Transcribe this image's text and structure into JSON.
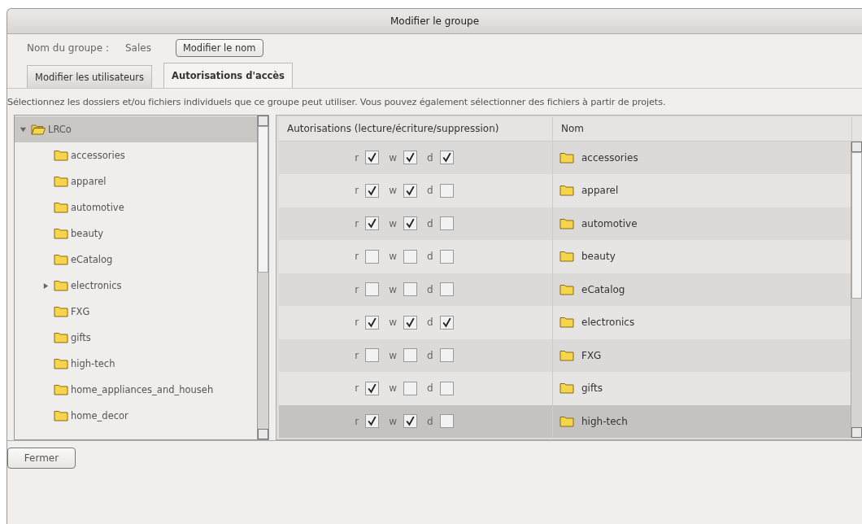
{
  "window": {
    "title": "Modifier le groupe"
  },
  "group": {
    "label": "Nom du groupe :",
    "value": "Sales",
    "rename_button": "Modifier le nom"
  },
  "tabs": [
    {
      "label": "Modifier les utilisateurs",
      "selected": false
    },
    {
      "label": "Autorisations d'accès",
      "selected": true
    }
  ],
  "description": "Sélectionnez les dossiers et/ou fichiers individuels que ce groupe peut utiliser. Vous pouvez également sélectionner des fichiers à partir de projets.",
  "tree": [
    {
      "label": "LRCo",
      "selected": true,
      "expanded": true,
      "children": [
        {
          "label": "accessories",
          "selected": false
        },
        {
          "label": "apparel",
          "selected": false
        },
        {
          "label": "automotive",
          "selected": false
        },
        {
          "label": "beauty",
          "selected": false
        },
        {
          "label": "eCatalog",
          "selected": false
        },
        {
          "label": "electronics",
          "selected": false,
          "expanded": false
        },
        {
          "label": "FXG",
          "selected": false
        },
        {
          "label": "gifts",
          "selected": false
        },
        {
          "label": "high-tech",
          "selected": false
        },
        {
          "label": "home_appliances_and_househ",
          "selected": false
        },
        {
          "label": "home_decor",
          "selected": false
        }
      ]
    }
  ],
  "table": {
    "columns": [
      "Autorisations (lecture/écriture/suppression)",
      "Nom"
    ],
    "rows": [
      {
        "permissions": [
          {
            "letter": "r",
            "checked": true
          },
          {
            "letter": "w",
            "checked": true
          },
          {
            "letter": "d",
            "checked": true
          }
        ],
        "name": "accessories",
        "selected": false
      },
      {
        "permissions": [
          {
            "letter": "r",
            "checked": true
          },
          {
            "letter": "w",
            "checked": true
          },
          {
            "letter": "d",
            "checked": false
          }
        ],
        "name": "apparel",
        "selected": false
      },
      {
        "permissions": [
          {
            "letter": "r",
            "checked": true
          },
          {
            "letter": "w",
            "checked": true
          },
          {
            "letter": "d",
            "checked": false
          }
        ],
        "name": "automotive",
        "selected": false
      },
      {
        "permissions": [
          {
            "letter": "r",
            "checked": false
          },
          {
            "letter": "w",
            "checked": false
          },
          {
            "letter": "d",
            "checked": false
          }
        ],
        "name": "beauty",
        "selected": false
      },
      {
        "permissions": [
          {
            "letter": "r",
            "checked": false
          },
          {
            "letter": "w",
            "checked": false
          },
          {
            "letter": "d",
            "checked": false
          }
        ],
        "name": "eCatalog",
        "selected": false
      },
      {
        "permissions": [
          {
            "letter": "r",
            "checked": true
          },
          {
            "letter": "w",
            "checked": true
          },
          {
            "letter": "d",
            "checked": true
          }
        ],
        "name": "electronics",
        "selected": false
      },
      {
        "permissions": [
          {
            "letter": "r",
            "checked": false
          },
          {
            "letter": "w",
            "checked": false
          },
          {
            "letter": "d",
            "checked": false
          }
        ],
        "name": "FXG",
        "selected": false
      },
      {
        "permissions": [
          {
            "letter": "r",
            "checked": true
          },
          {
            "letter": "w",
            "checked": false
          },
          {
            "letter": "d",
            "checked": false
          }
        ],
        "name": "gifts",
        "selected": false
      },
      {
        "permissions": [
          {
            "letter": "r",
            "checked": true
          },
          {
            "letter": "w",
            "checked": true
          },
          {
            "letter": "d",
            "checked": false
          }
        ],
        "name": "high-tech",
        "selected": true
      }
    ]
  },
  "buttons": [
    "Fermer"
  ]
}
